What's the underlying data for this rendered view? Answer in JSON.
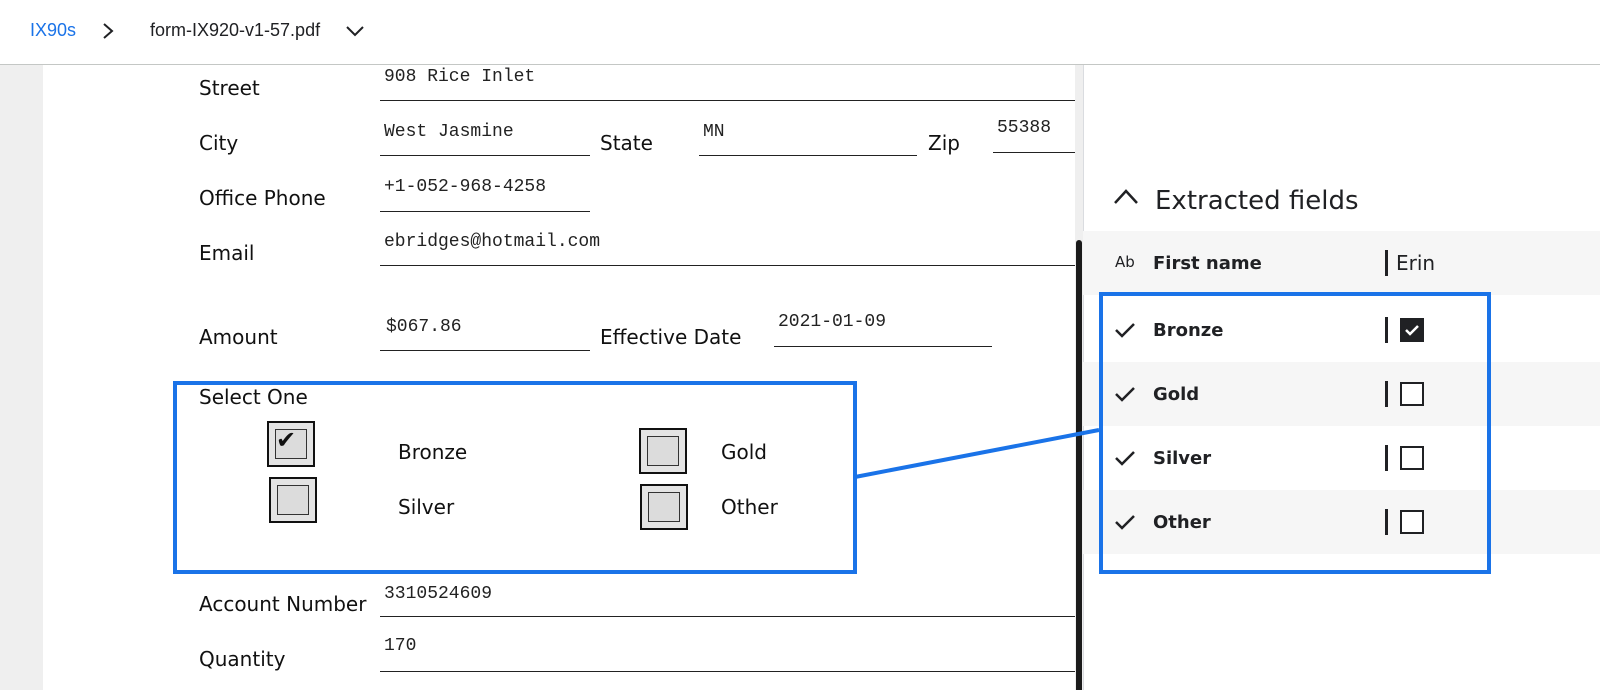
{
  "breadcrumb": {
    "root": "IX90s",
    "file": "form-IX920-v1-57.pdf"
  },
  "form": {
    "street_label": "Street",
    "street_value": "908 Rice Inlet",
    "city_label": "City",
    "city_value": "West Jasmine",
    "state_label": "State",
    "state_value": "MN",
    "zip_label": "Zip",
    "zip_value": "55388",
    "phone_label": "Office Phone",
    "phone_value": "+1-052-968-4258",
    "email_label": "Email",
    "email_value": "ebridges@hotmail.com",
    "amount_label": "Amount",
    "amount_value": "$067.86",
    "date_label": "Effective Date",
    "date_value": "2021-01-09",
    "select_label": "Select One",
    "options": {
      "bronze": {
        "label": "Bronze",
        "checked": true
      },
      "gold": {
        "label": "Gold",
        "checked": false
      },
      "silver": {
        "label": "Silver",
        "checked": false
      },
      "other": {
        "label": "Other",
        "checked": false
      }
    },
    "account_label": "Account Number",
    "account_value": "3310524609",
    "quantity_label": "Quantity",
    "quantity_value": "170"
  },
  "panel": {
    "title": "Extracted fields",
    "fields": [
      {
        "icon": "text-type-icon",
        "icon_text": "Ab",
        "name": "First name",
        "value": "Erin"
      },
      {
        "icon": "check-icon",
        "name": "Bronze",
        "checked": true
      },
      {
        "icon": "check-icon",
        "name": "Gold",
        "checked": false
      },
      {
        "icon": "check-icon",
        "name": "Silver",
        "checked": false
      },
      {
        "icon": "check-icon",
        "name": "Other",
        "checked": false
      }
    ]
  },
  "colors": {
    "accent": "#1a73e8",
    "text": "#202124",
    "row_alt": "#f6f6f6",
    "doc_bg": "#efefef"
  }
}
